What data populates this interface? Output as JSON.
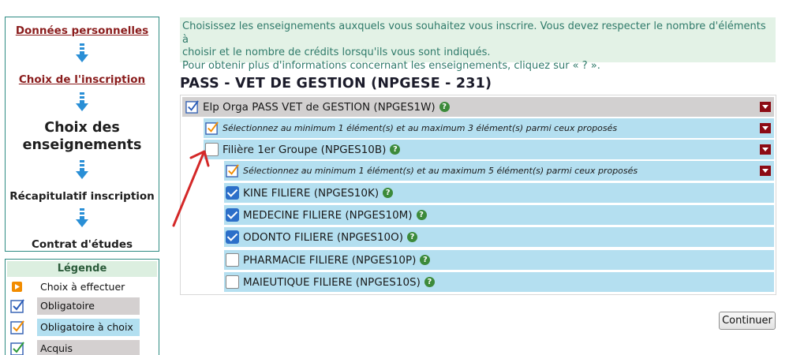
{
  "steps": {
    "personal_data": "Données personnelles",
    "registration_choice": "Choix de l'inscription",
    "courses_choice_line1": "Choix des",
    "courses_choice_line2": "enseignements",
    "summary": "Récapitulatif inscription",
    "contract": "Contrat d'études"
  },
  "legend": {
    "title": "Légende",
    "items": [
      {
        "label": "Choix à effectuer",
        "icon": "orange-play-icon"
      },
      {
        "label": "Obligatoire",
        "icon": "blue-check-icon"
      },
      {
        "label": "Obligatoire à choix",
        "icon": "orange-check-icon"
      },
      {
        "label": "Acquis",
        "icon": "green-check-icon"
      }
    ]
  },
  "info": {
    "line1": "Choisissez les enseignements auxquels vous souhaitez vous inscrire. Vous devez respecter le nombre d'éléments à",
    "line2": "choisir et le nombre de crédits lorsqu'ils vous sont indiqués.",
    "line3": "Pour obtenir plus d'informations concernant les enseignements, cliquez sur « ? »."
  },
  "program_title": "PASS - VET DE GESTION (NPGESE - 231)",
  "tree": {
    "elp_label": "Elp Orga PASS VET de GESTION (NPGES1W)",
    "rule1": "Sélectionnez au minimum 1 élément(s) et au maximum 3 élément(s) parmi ceux proposés",
    "filiere_label": "Filière 1er Groupe (NPGES10B)",
    "rule2": "Sélectionnez au minimum 1 élément(s) et au maximum 5 élément(s) parmi ceux proposés",
    "options": [
      {
        "label": "KINE FILIERE (NPGES10K)",
        "checked": true
      },
      {
        "label": "MEDECINE FILIERE (NPGES10M)",
        "checked": true
      },
      {
        "label": "ODONTO FILIERE (NPGES10O)",
        "checked": true
      },
      {
        "label": "PHARMACIE FILIERE (NPGES10P)",
        "checked": false
      },
      {
        "label": "MAIEUTIQUE FILIERE (NPGES10S)",
        "checked": false
      }
    ],
    "help_glyph": "?"
  },
  "continue_label": "Continuer",
  "colors": {
    "brand_teal": "#2e8b83",
    "link_red": "#8a1c1c",
    "row_blue": "#b4dff0",
    "row_grey": "#d2d0d0",
    "collapse_red": "#8c0b14",
    "annotation_red": "#d42828"
  }
}
